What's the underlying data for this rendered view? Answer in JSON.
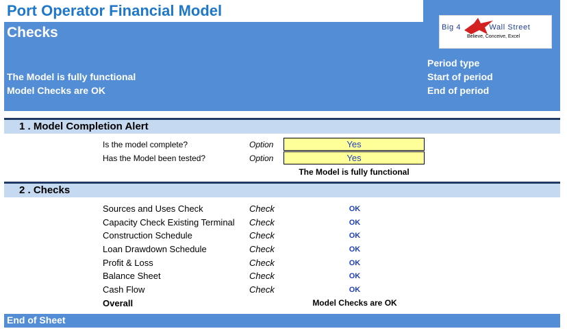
{
  "header": {
    "title": "Port Operator Financial Model",
    "subtitle": "Checks",
    "status_line_1": "The Model is fully functional",
    "status_line_2": "Model Checks are OK",
    "period_type_label": "Period type",
    "start_of_period_label": "Start of period",
    "end_of_period_label": "End of period",
    "logo": {
      "text_left": "Big 4",
      "text_right": "Wall Street",
      "tagline": "Believe, Conceive, Excel"
    }
  },
  "section1": {
    "title": "1 . Model Completion Alert",
    "rows": [
      {
        "label": "Is the model complete?",
        "type": "Option",
        "value": "Yes"
      },
      {
        "label": "Has the Model been tested?",
        "type": "Option",
        "value": "Yes"
      }
    ],
    "status": "The Model is fully functional"
  },
  "section2": {
    "title": "2 . Checks",
    "rows": [
      {
        "label": "Sources and Uses Check",
        "type": "Check",
        "value": "OK"
      },
      {
        "label": "Capacity Check Existing Terminal",
        "type": "Check",
        "value": "OK"
      },
      {
        "label": "Construction Schedule",
        "type": "Check",
        "value": "OK"
      },
      {
        "label": "Loan Drawdown Schedule",
        "type": "Check",
        "value": "OK"
      },
      {
        "label": "Profit & Loss",
        "type": "Check",
        "value": "OK"
      },
      {
        "label": "Balance Sheet",
        "type": "Check",
        "value": "OK"
      },
      {
        "label": "Cash Flow",
        "type": "Check",
        "value": "OK"
      }
    ],
    "overall_label": "Overall",
    "overall_status": "Model Checks are OK"
  },
  "footer": {
    "end_text": "End of Sheet"
  },
  "colors": {
    "title_blue": "#1f77c9",
    "header_band": "#538dd5",
    "section_band": "#c5d9f1",
    "input_cell": "#ffff99",
    "ok_text": "#1f3fbf"
  }
}
